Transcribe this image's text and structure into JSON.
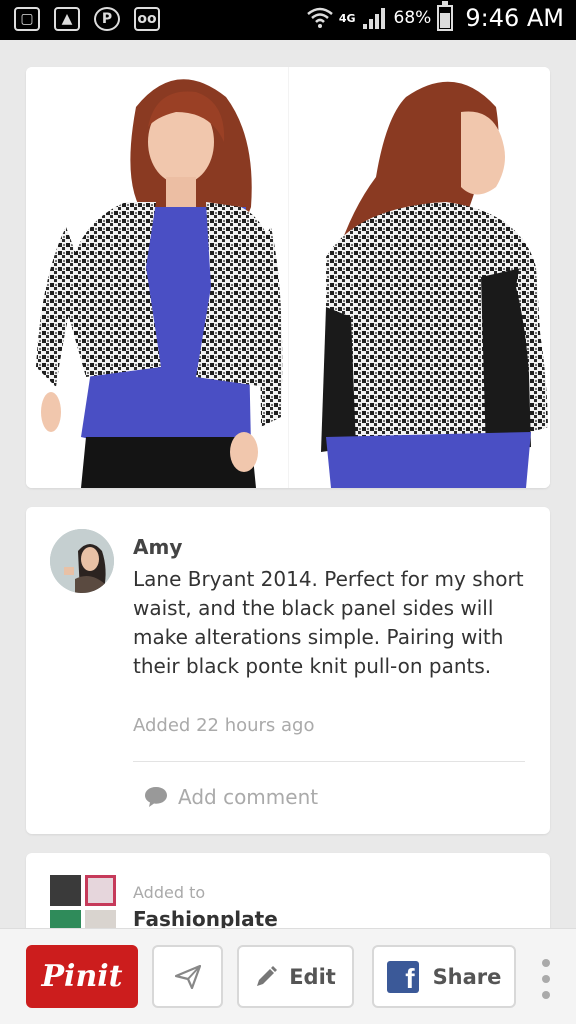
{
  "status_bar": {
    "network": "4G",
    "battery_percent": "68%",
    "battery_level": 0.68,
    "time": "9:46 AM",
    "icons": [
      "screenshot-icon",
      "gallery-icon",
      "pinterest-icon",
      "voicemail-icon",
      "wifi-icon",
      "signal-icon",
      "battery-icon"
    ]
  },
  "pin": {
    "image_description_icon": "product-photo",
    "author": "Amy",
    "description": "Lane Bryant 2014. Perfect for my short waist, and the black panel sides will make alterations simple. Pairing with their black ponte knit pull-on pants.",
    "added": "Added 22 hours ago",
    "comment_placeholder": "Add comment"
  },
  "board": {
    "added_to_label": "Added to",
    "name": "Fashionplate"
  },
  "actions": {
    "pinit_label": "Pinit",
    "edit_label": "Edit",
    "share_label": "Share"
  },
  "colors": {
    "pinit_red": "#cc1d1d",
    "facebook_blue": "#3b5998",
    "blouse_blue": "#4a4fc4"
  }
}
